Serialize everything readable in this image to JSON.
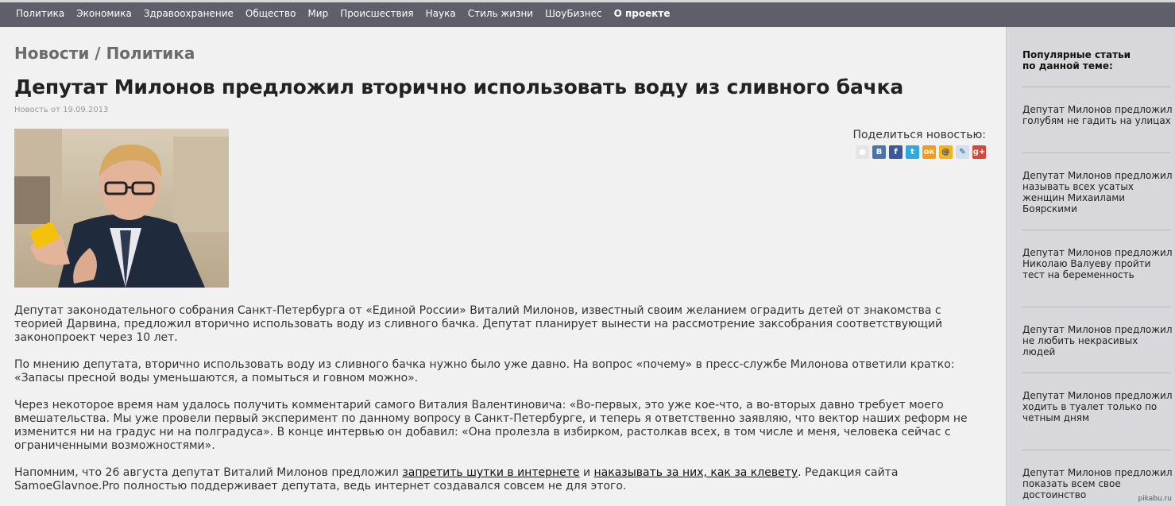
{
  "nav": {
    "items": [
      "Политика",
      "Экономика",
      "Здравоохранение",
      "Общество",
      "Мир",
      "Происшествия",
      "Наука",
      "Стиль жизни",
      "ШоуБизнес"
    ],
    "about": "О проекте"
  },
  "breadcrumb": "Новости / Политика",
  "article": {
    "title": "Депутат Милонов предложил вторично использовать воду из сливного бачка",
    "date": "Новость от 19.09.2013",
    "p1": "Депутат законодательного собрания Санкт-Петербурга от «Единой России» Виталий Милонов, известный своим желанием оградить детей от знакомства с теорией Дарвина, предложил вторично использовать воду из сливного бачка. Депутат планирует вынести на рассмотрение заксобрания соответствующий законопроект через 10 лет.",
    "p2": "По мнению депутата, вторично использовать воду из сливного бачка нужно было уже давно. На вопрос «почему» в пресс-службе Милонова ответили кратко: «Запасы пресной воды уменьшаются, а помыться и говном можно».",
    "p3": "Через некоторое время нам удалось получить комментарий самого Виталия Валентиновича: «Во-первых, это уже кое-что, а во-вторых давно требует моего вмешательства. Мы уже провели первый эксперимент по данному вопросу в Санкт-Петербурге, и теперь я ответственно заявляю, что вектор наших реформ не изменится ни на градус ни на полградуса». В конце интервью он добавил: «Она пролезла в избирком, растолкав всех, в том числе и меня, человека сейчас с ограниченными возможностями».",
    "p4_start": "Напомним, что 26 августа депутат Виталий Милонов предложил ",
    "p4_link1": "запретить шутки в интернете",
    "p4_mid": " и ",
    "p4_link2": "наказывать за них, как за клевету",
    "p4_end": ". Редакция сайта SamoeGlavnoe.Pro полностью поддерживает депутата, ведь интернет создавался совсем не для этого."
  },
  "share": {
    "label": "Поделиться новостью:",
    "icons": [
      {
        "name": "bookmark",
        "glyph": "●",
        "color": "#ffffff",
        "bg": "#e5e5e5"
      },
      {
        "name": "vk",
        "glyph": "B",
        "color": "#ffffff",
        "bg": "#4c75a3"
      },
      {
        "name": "facebook",
        "glyph": "f",
        "color": "#ffffff",
        "bg": "#3b5998"
      },
      {
        "name": "twitter",
        "glyph": "t",
        "color": "#ffffff",
        "bg": "#2fa8e0"
      },
      {
        "name": "odnoklassniki",
        "glyph": "ок",
        "color": "#ffffff",
        "bg": "#f59a1d"
      },
      {
        "name": "mailru",
        "glyph": "@",
        "color": "#1c3c8a",
        "bg": "#f5b31b"
      },
      {
        "name": "livejournal",
        "glyph": "✎",
        "color": "#1a4e8a",
        "bg": "#cfe0ef"
      },
      {
        "name": "googleplus",
        "glyph": "g+",
        "color": "#ffffff",
        "bg": "#d34836"
      }
    ]
  },
  "sidebar": {
    "heading_line1": "Популярные статьи",
    "heading_line2": "по данной теме:",
    "items": [
      "Депутат Милонов предложил голубям не гадить на улицах",
      "Депутат Милонов предложил называть всех усатых женщин Михаилами Боярскими",
      "Депутат Милонов предложил Николаю Валуеву пройти тест на беременность",
      "Депутат Милонов предложил не любить некрасивых людей",
      "Депутат Милонов предложил ходить в туалет только по четным дням",
      "Депутат Милонов предложил показать всем свое достоинство"
    ]
  },
  "watermark": "pikabu.ru"
}
